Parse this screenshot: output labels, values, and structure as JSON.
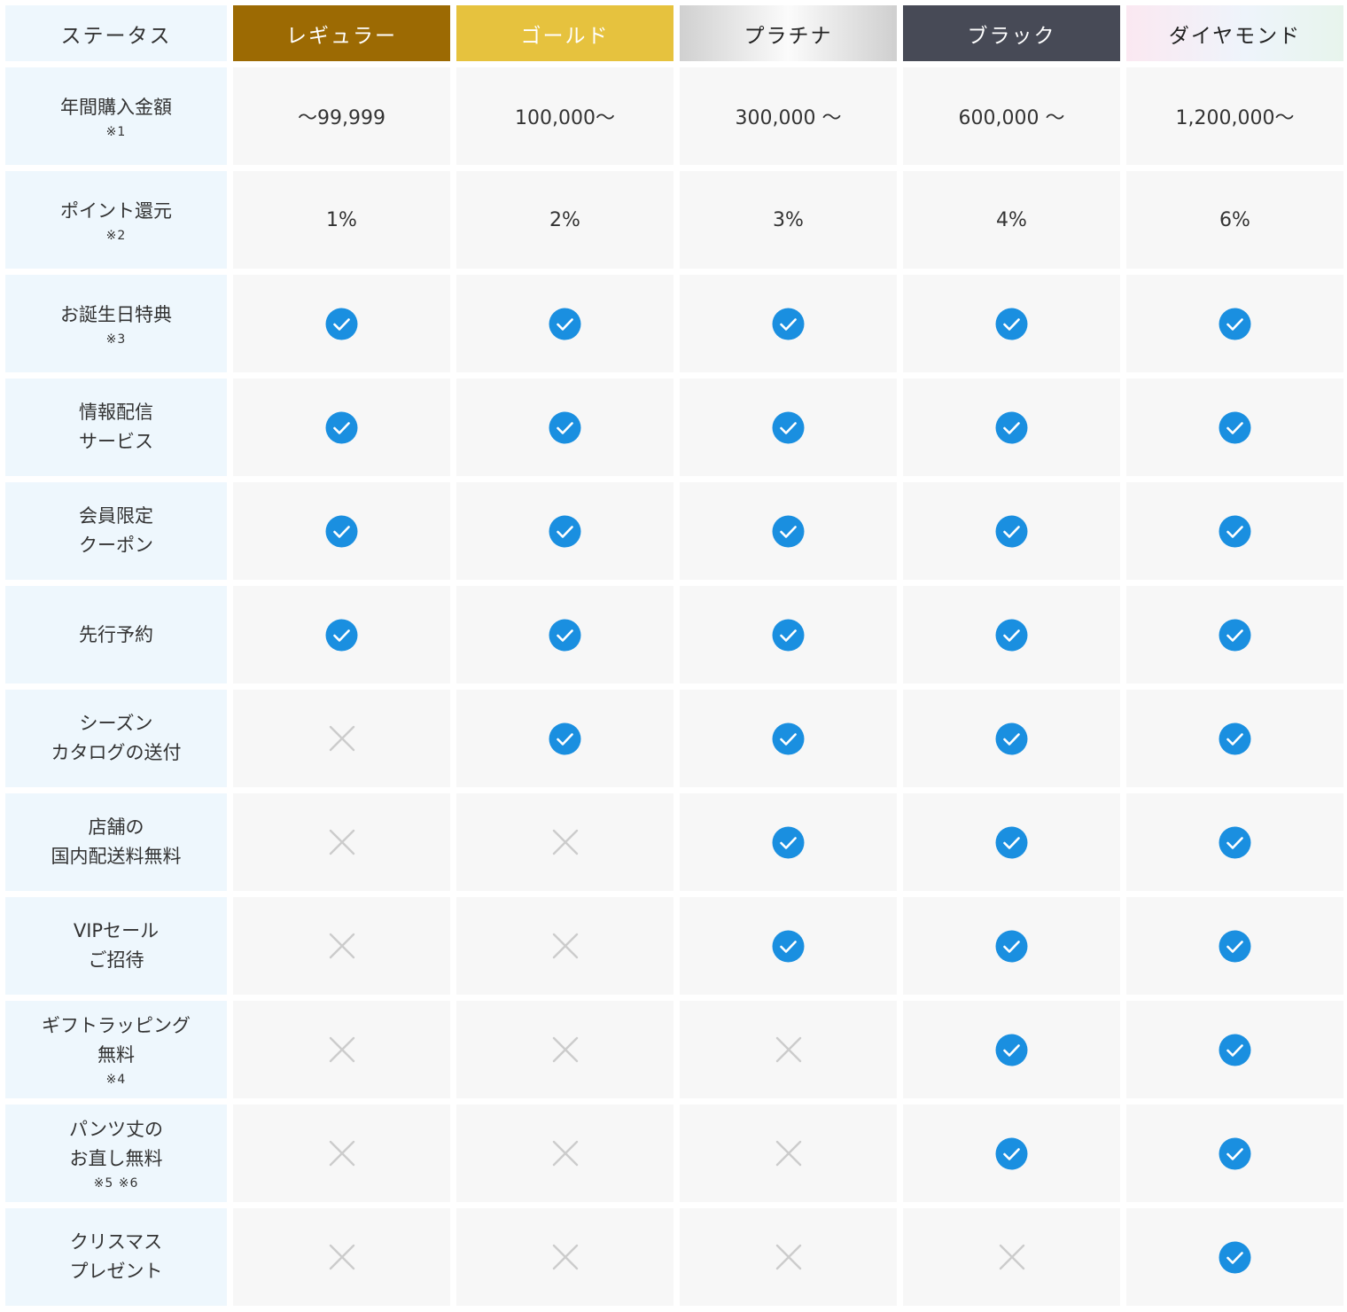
{
  "header": {
    "status_label": "ステータス",
    "tiers": [
      {
        "name": "レギュラー",
        "text_color": "#ffffff",
        "bg": "#9c6a03"
      },
      {
        "name": "ゴールド",
        "text_color": "#ffffff",
        "bg": "#e6c23e"
      },
      {
        "name": "プラチナ",
        "text_color": "#222222",
        "bg": "linear-gradient(90deg,#d0d0d0 0%,#fbfbfb 50%,#cfcfcf 100%)"
      },
      {
        "name": "ブラック",
        "text_color": "#ffffff",
        "bg": "#474a56"
      },
      {
        "name": "ダイヤモンド",
        "text_color": "#222222",
        "bg": "linear-gradient(90deg,#fbe8f1 0%,#eef4fb 55%,#e7f4ec 100%)"
      }
    ]
  },
  "colors": {
    "check": "#1a8fe0",
    "cross": "#cccccc"
  },
  "rows": [
    {
      "label": [
        "年間購入金額"
      ],
      "note": "※1",
      "values": [
        "〜99,999",
        "100,000〜",
        "300,000 〜",
        "600,000 〜",
        "1,200,000〜"
      ]
    },
    {
      "label": [
        "ポイント還元"
      ],
      "note": "※2",
      "values": [
        "1%",
        "2%",
        "3%",
        "4%",
        "6%"
      ]
    },
    {
      "label": [
        "お誕生日特典"
      ],
      "note": "※3",
      "values": [
        "check",
        "check",
        "check",
        "check",
        "check"
      ]
    },
    {
      "label": [
        "情報配信",
        "サービス"
      ],
      "note": "",
      "values": [
        "check",
        "check",
        "check",
        "check",
        "check"
      ]
    },
    {
      "label": [
        "会員限定",
        "クーポン"
      ],
      "note": "",
      "values": [
        "check",
        "check",
        "check",
        "check",
        "check"
      ]
    },
    {
      "label": [
        "先行予約"
      ],
      "note": "",
      "values": [
        "check",
        "check",
        "check",
        "check",
        "check"
      ]
    },
    {
      "label": [
        "シーズン",
        "カタログの送付"
      ],
      "note": "",
      "values": [
        "cross",
        "check",
        "check",
        "check",
        "check"
      ]
    },
    {
      "label": [
        "店舗の",
        "国内配送料無料"
      ],
      "note": "",
      "values": [
        "cross",
        "cross",
        "check",
        "check",
        "check"
      ]
    },
    {
      "label": [
        "VIPセール",
        "ご招待"
      ],
      "note": "",
      "values": [
        "cross",
        "cross",
        "check",
        "check",
        "check"
      ]
    },
    {
      "label": [
        "ギフトラッピング",
        "無料"
      ],
      "note": "※4",
      "values": [
        "cross",
        "cross",
        "cross",
        "check",
        "check"
      ]
    },
    {
      "label": [
        "パンツ丈の",
        "お直し無料"
      ],
      "note": "※5 ※6",
      "values": [
        "cross",
        "cross",
        "cross",
        "check",
        "check"
      ]
    },
    {
      "label": [
        "クリスマス",
        "プレゼント"
      ],
      "note": "",
      "values": [
        "cross",
        "cross",
        "cross",
        "cross",
        "check"
      ]
    }
  ]
}
